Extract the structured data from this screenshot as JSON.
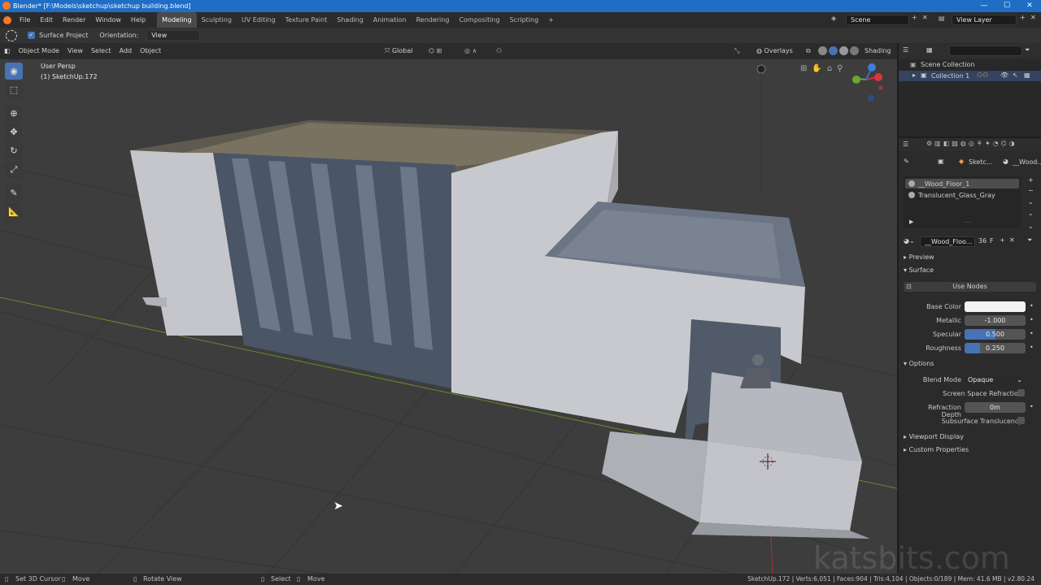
{
  "window": {
    "title": "Blender* [F:\\Models\\sketchup\\sketchup building.blend]",
    "minimize": "—",
    "maximize": "☐",
    "close": "✕"
  },
  "menubar": {
    "menus": [
      "File",
      "Edit",
      "Render",
      "Window",
      "Help"
    ],
    "workspaces": [
      "Modeling",
      "Sculpting",
      "UV Editing",
      "Texture Paint",
      "Shading",
      "Animation",
      "Rendering",
      "Compositing",
      "Scripting"
    ],
    "active_workspace": "Modeling",
    "add_workspace": "+",
    "scene_name": "Scene",
    "view_layer": "View Layer"
  },
  "tool_settings": {
    "surface_project_label": "Surface Project",
    "surface_project_checked": true,
    "orientation_label": "Orientation:",
    "orientation_value": "View"
  },
  "viewport_header": {
    "mode": "Object Mode",
    "menus": [
      "View",
      "Select",
      "Add",
      "Object"
    ],
    "transform_orientation": "Global",
    "overlays": "Overlays",
    "shading": "Shading"
  },
  "viewport": {
    "view_name": "User Persp",
    "object_info": "(1) SketchUp.172",
    "watermark": "katsbits.com"
  },
  "outliner": {
    "search_placeholder": "",
    "scene_collection": "Scene Collection",
    "collection": "Collection 1"
  },
  "properties": {
    "breadcrumb_object": "Sketc...",
    "breadcrumb_material": "__Wood...",
    "material_slots": [
      "__Wood_Floor_1",
      "Translucent_Glass_Gray"
    ],
    "active_material": "__Wood_Floo...",
    "user_count": "36",
    "fake_user": "F",
    "sections": {
      "preview": "Preview",
      "surface": "Surface",
      "options": "Options",
      "viewport_display": "Viewport Display",
      "custom_properties": "Custom Properties"
    },
    "use_nodes": "Use Nodes",
    "base_color_label": "Base Color",
    "base_color": "#f2f2f2",
    "metallic_label": "Metallic",
    "metallic": "-1.000",
    "metallic_fraction": 0.0,
    "specular_label": "Specular",
    "specular": "0.500",
    "specular_fraction": 0.5,
    "roughness_label": "Roughness",
    "roughness": "0.250",
    "roughness_fraction": 0.25,
    "blend_mode_label": "Blend Mode",
    "blend_mode": "Opaque",
    "ssr_label": "Screen Space Refraction",
    "refraction_depth_label": "Refraction Depth",
    "refraction_depth": "0m",
    "sss_label": "Subsurface Translucency"
  },
  "statusbar": {
    "items": [
      "Set 3D Cursor",
      "Move",
      "Rotate View",
      "Select",
      "Move"
    ],
    "stats": "SketchUp.172 | Verts:6,051 | Faces:904 | Tris:4,104 | Objects:0/189 | Mem: 41.6 MB | v2.80.24"
  },
  "colors": {
    "accent": "#4772b3",
    "title_bar": "#1f6dc4",
    "viewport_bg": "#3d3d3d"
  }
}
